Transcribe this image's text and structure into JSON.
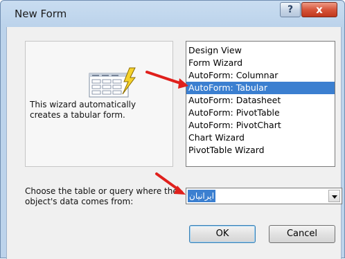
{
  "window": {
    "title": "New Form",
    "help_label": "?",
    "close_label": "x"
  },
  "preview": {
    "description": "This wizard automatically creates a tabular form."
  },
  "wizard_list": {
    "items": [
      {
        "label": "Design View",
        "selected": false
      },
      {
        "label": "Form Wizard",
        "selected": false
      },
      {
        "label": "AutoForm: Columnar",
        "selected": false
      },
      {
        "label": "AutoForm: Tabular",
        "selected": true
      },
      {
        "label": "AutoForm: Datasheet",
        "selected": false
      },
      {
        "label": "AutoForm: PivotTable",
        "selected": false
      },
      {
        "label": "AutoForm: PivotChart",
        "selected": false
      },
      {
        "label": "Chart Wizard",
        "selected": false
      },
      {
        "label": "PivotTable Wizard",
        "selected": false
      }
    ]
  },
  "data_source": {
    "label": "Choose the table or query where the object's data comes from:",
    "selected_value": "ایرانیان"
  },
  "buttons": {
    "ok_label": "OK",
    "cancel_label": "Cancel"
  },
  "colors": {
    "selection": "#3b7fd0",
    "annotation_arrow": "#e0201c",
    "close_button": "#c0371c"
  }
}
